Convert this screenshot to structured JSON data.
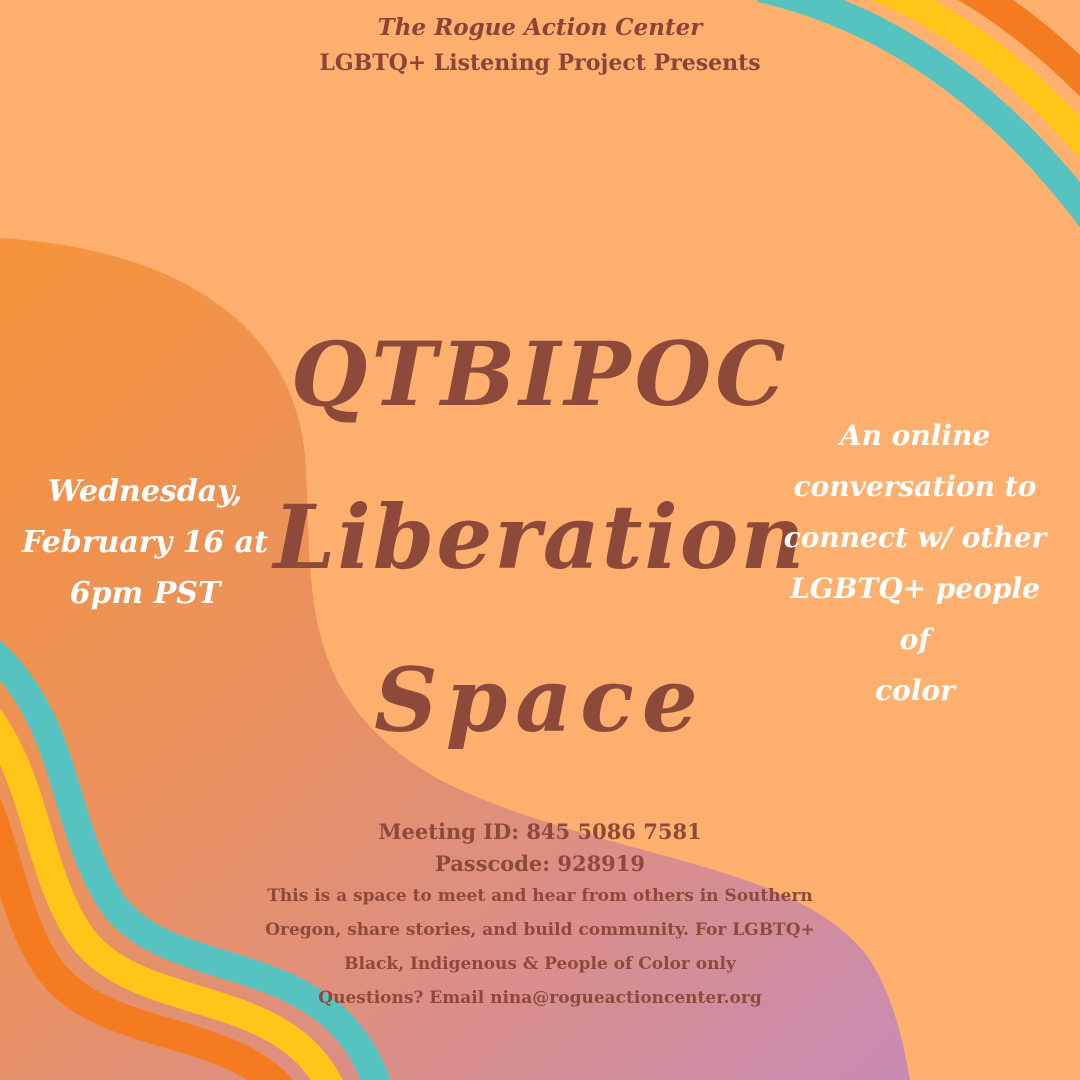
{
  "header": {
    "org_name": "The Rogue Action Center",
    "project": "LGBTQ+ Listening Project Presents"
  },
  "title": {
    "line1": "QTBIPOC",
    "line2": "Liberation",
    "line3": "Space"
  },
  "event": {
    "date_line1": "Wednesday,",
    "date_line2": "February 16 at",
    "date_line3": "6pm PST"
  },
  "description": {
    "line1": "An online",
    "line2": "conversation to",
    "line3": "connect w/ other",
    "line4": "LGBTQ+ people of",
    "line5": "color"
  },
  "meeting": {
    "id_line": "Meeting ID: 845 5086 7581",
    "passcode_line": "Passcode: 928919"
  },
  "about": {
    "line1": "This is a space to meet and hear from others in Southern",
    "line2": "Oregon, share stories, and build community. For LGBTQ+",
    "line3": "Black, Indigenous & People of Color only",
    "line4": "Questions? Email nina@rogueactioncenter.org"
  },
  "colors": {
    "background": "#FFB06E",
    "title_text": "#8D4A3A",
    "white_text": "#FFFFFF",
    "stripe_teal": "#56C3C1",
    "stripe_yellow": "#FFC619",
    "stripe_orange": "#F47B20"
  }
}
